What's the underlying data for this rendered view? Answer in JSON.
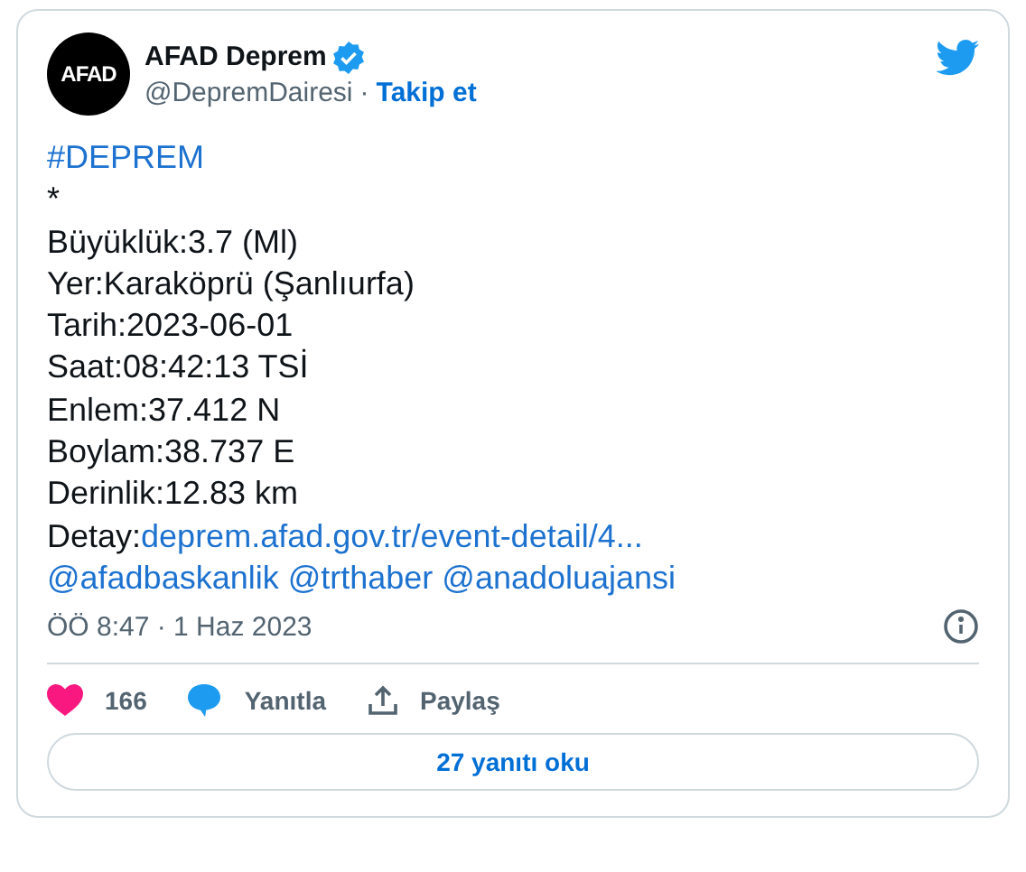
{
  "author": {
    "avatar_text": "AFAD",
    "name": "AFAD Deprem",
    "verified": true,
    "handle": "@DepremDairesi",
    "separator": "·",
    "follow": "Takip et"
  },
  "lines": [
    {
      "kind": "link",
      "text": "#DEPREM"
    },
    {
      "kind": "plain",
      "text": "*"
    },
    {
      "kind": "plain",
      "text": "Büyüklük:3.7 (Ml)"
    },
    {
      "kind": "plain",
      "text": "Yer:Karaköprü (Şanlıurfa)"
    },
    {
      "kind": "plain",
      "text": "Tarih:2023-06-01"
    },
    {
      "kind": "plain",
      "text": "Saat:08:42:13 TSİ"
    },
    {
      "kind": "plain",
      "text": "Enlem:37.412 N"
    },
    {
      "kind": "plain",
      "text": "Boylam:38.737 E"
    },
    {
      "kind": "plain",
      "text": "Derinlik:12.83 km"
    },
    {
      "kind": "labeled",
      "label": "Detay:",
      "link": "deprem.afad.gov.tr/event-detail/4..."
    },
    {
      "kind": "mentions",
      "items": [
        "@afadbaskanlik",
        "@trthaber",
        "@anadoluajansi"
      ]
    }
  ],
  "timestamp": "ÖÖ 8:47 · 1 Haz 2023",
  "actions": [
    {
      "kind": "like",
      "label": "166"
    },
    {
      "kind": "reply",
      "label": "Yanıtla"
    },
    {
      "kind": "share",
      "label": "Paylaş"
    }
  ],
  "read_replies": "27 yanıtı oku"
}
